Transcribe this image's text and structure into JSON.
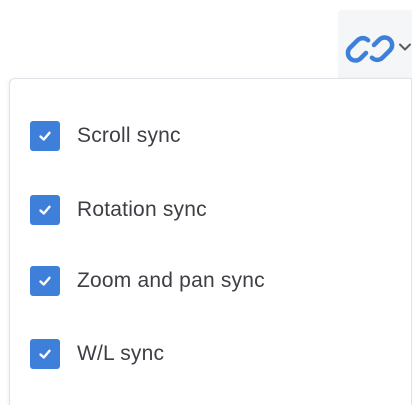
{
  "toolbar": {
    "link_button_icon": "link-icon",
    "dropdown_icon": "chevron-down-icon",
    "accent_color": "#3d7fd9"
  },
  "sync_menu": {
    "items": [
      {
        "label": "Scroll sync",
        "checked": true,
        "icon": "checkmark-icon"
      },
      {
        "label": "Rotation sync",
        "checked": true,
        "icon": "checkmark-icon"
      },
      {
        "label": "Zoom and pan sync",
        "checked": true,
        "icon": "checkmark-icon"
      },
      {
        "label": "W/L sync",
        "checked": true,
        "icon": "checkmark-icon"
      }
    ]
  }
}
